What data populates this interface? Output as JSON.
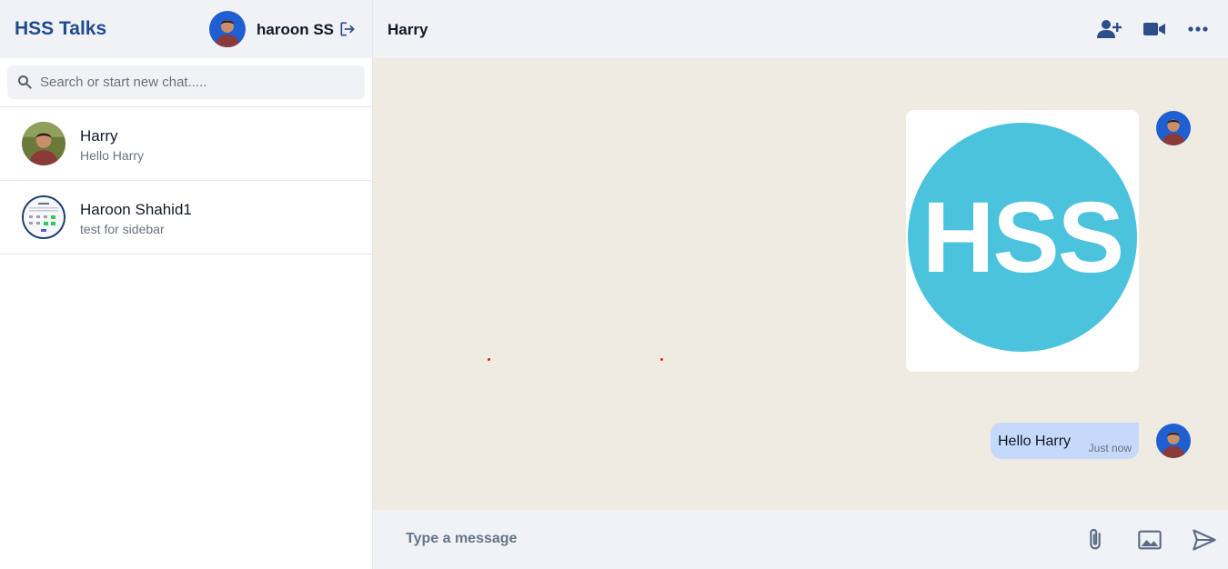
{
  "sidebar": {
    "brand": "HSS Talks",
    "user": {
      "name": "haroon SS",
      "avatar_icon": "user-avatar"
    },
    "logout_icon": "logout-icon",
    "search": {
      "placeholder": "Search or start new chat.....",
      "value": ""
    },
    "chats": [
      {
        "name": "Harry",
        "preview": "Hello Harry",
        "avatar_icon": "user-avatar"
      },
      {
        "name": "Haroon Shahid1",
        "preview": "test for sidebar",
        "avatar_icon": "screenshot-thumbnail"
      }
    ]
  },
  "chat": {
    "title": "Harry",
    "header_icons": [
      "add-user-icon",
      "video-call-icon",
      "more-options-icon"
    ],
    "messages": [
      {
        "type": "image",
        "image_text": "HSS"
      },
      {
        "type": "text",
        "text": "Hello Harry",
        "time": "Just now"
      }
    ],
    "composer": {
      "placeholder": "Type a message",
      "value": ""
    },
    "composer_icons": [
      "attach-icon",
      "image-icon",
      "send-icon"
    ]
  },
  "colors": {
    "brand": "#1e4b8f",
    "header_bg": "#f0f2f5",
    "chat_bg": "#efeae2",
    "bubble": "#c5d9fa",
    "icon": "#2c4f8c",
    "logo_circle": "#4cc3dd"
  }
}
